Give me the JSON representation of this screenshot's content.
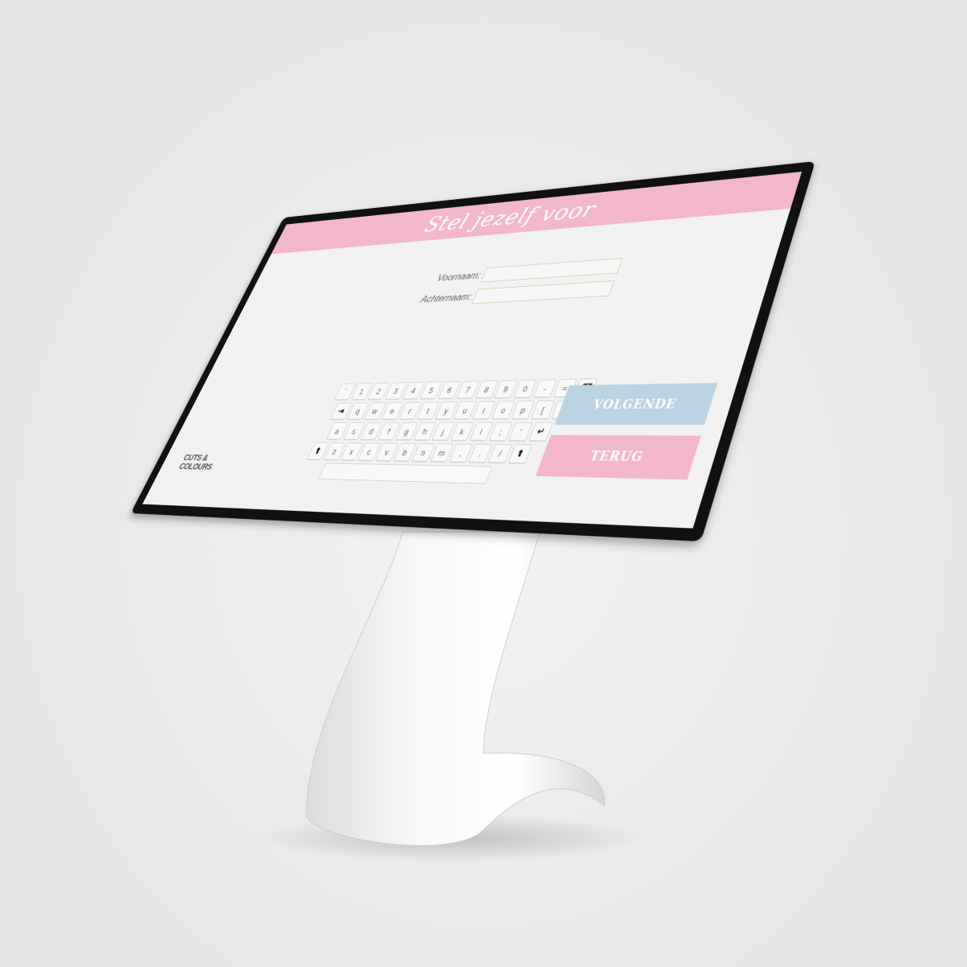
{
  "screen": {
    "title": "Stel jezelf voor",
    "form": {
      "first_name_label": "Voornaam:",
      "first_name_value": "",
      "last_name_label": "Achternaam:",
      "last_name_value": ""
    },
    "keyboard": {
      "rows": [
        [
          "`",
          "1",
          "2",
          "3",
          "4",
          "5",
          "6",
          "7",
          "8",
          "9",
          "0",
          "-",
          "=",
          "⌫"
        ],
        [
          "⇥",
          "q",
          "w",
          "e",
          "r",
          "t",
          "y",
          "u",
          "i",
          "o",
          "p",
          "[",
          "]",
          "\\"
        ],
        [
          "a",
          "s",
          "d",
          "f",
          "g",
          "h",
          "j",
          "k",
          "l",
          ";",
          "'",
          "↵"
        ],
        [
          "⬆",
          "z",
          "x",
          "c",
          "v",
          "b",
          "n",
          "m",
          ",",
          ".",
          "/",
          "⬆"
        ]
      ]
    },
    "buttons": {
      "next_label": "VOLGENDE",
      "back_label": "TERUG"
    },
    "logo": {
      "line1": "CUTS &",
      "line2": "COLOURS"
    },
    "colors": {
      "accent_pink": "#f2b6cd",
      "accent_blue": "#bcd3e4"
    }
  }
}
